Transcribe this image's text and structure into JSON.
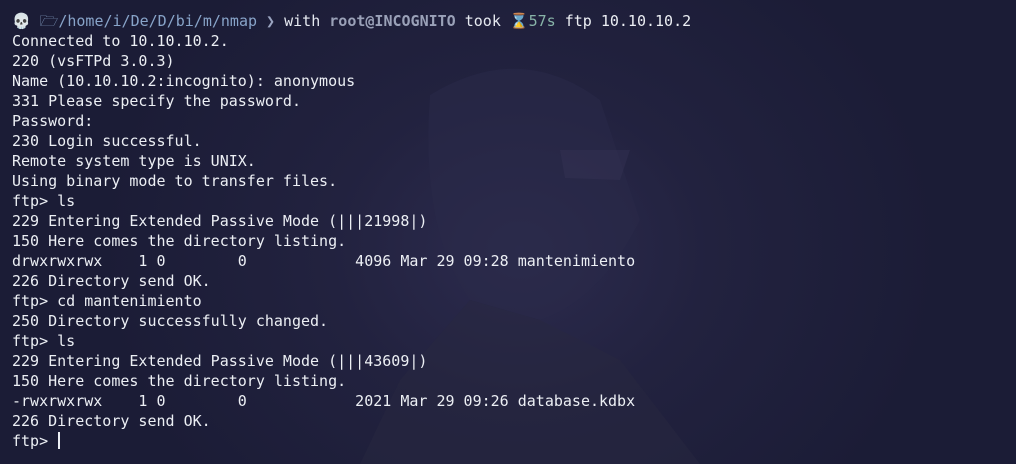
{
  "prompt": {
    "skull_glyph": "💀",
    "folder_glyph": "🗁",
    "path": "/home/i/De/D/bi/m/nmap",
    "chevron": "❯",
    "with_label": "with",
    "user": "root@INCOGNITO",
    "took_label": "took",
    "hourglass_glyph": "⌛",
    "duration": "57s",
    "command": "ftp 10.10.10.2"
  },
  "output": [
    "Connected to 10.10.10.2.",
    "220 (vsFTPd 3.0.3)",
    "Name (10.10.10.2:incognito): anonymous",
    "331 Please specify the password.",
    "Password:",
    "230 Login successful.",
    "Remote system type is UNIX.",
    "Using binary mode to transfer files.",
    "ftp> ls",
    "229 Entering Extended Passive Mode (|||21998|)",
    "150 Here comes the directory listing.",
    "drwxrwxrwx    1 0        0            4096 Mar 29 09:28 mantenimiento",
    "226 Directory send OK.",
    "ftp> cd mantenimiento",
    "250 Directory successfully changed.",
    "ftp> ls",
    "229 Entering Extended Passive Mode (|||43609|)",
    "150 Here comes the directory listing.",
    "-rwxrwxrwx    1 0        0            2021 Mar 29 09:26 database.kdbx",
    "226 Directory send OK."
  ],
  "ftp_prompt": "ftp> ",
  "colors": {
    "background": "#1b1c36",
    "text": "#eceff4",
    "path": "#88a4c9",
    "user": "#9aa1b8",
    "duration": "#88b4a8"
  }
}
